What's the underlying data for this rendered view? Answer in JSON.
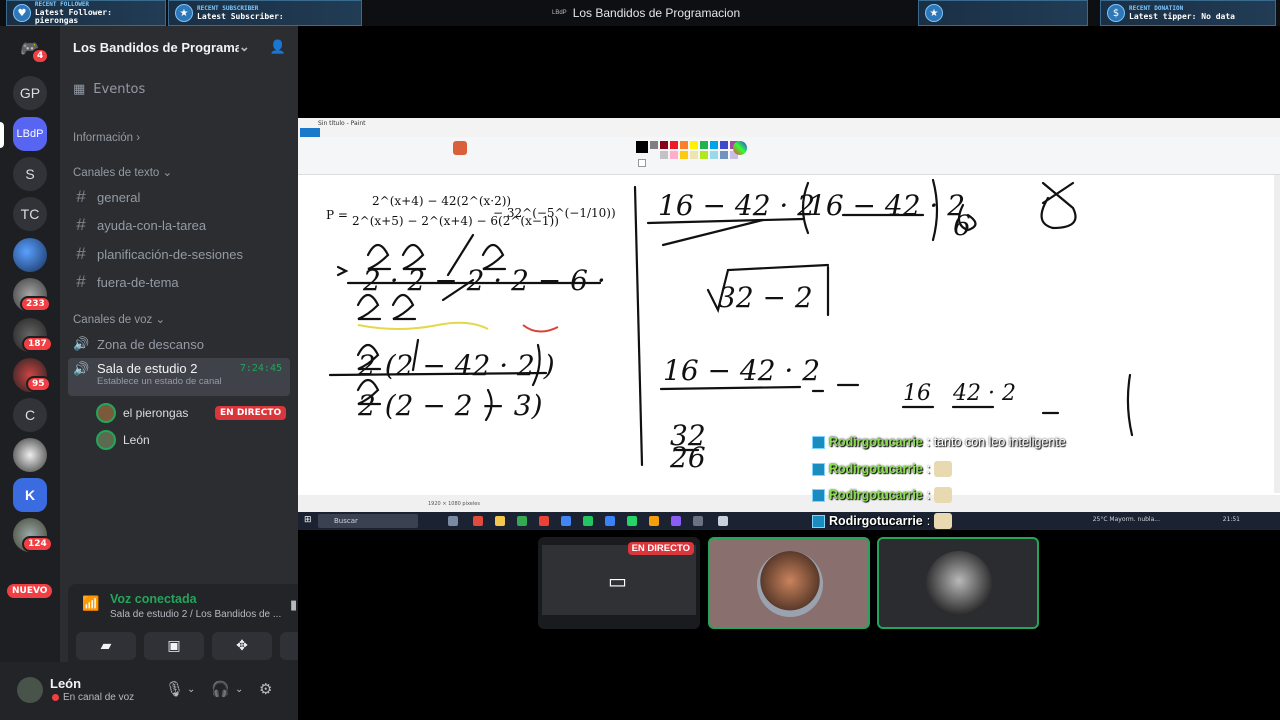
{
  "overlay": {
    "alerts_left": [
      {
        "key": "RECENT FOLLOWER",
        "value": "Latest Follower: pierongas"
      },
      {
        "key": "RECENT SUBSCRIBER",
        "value": "Latest Subscriber:"
      }
    ],
    "alerts_right": [
      {
        "key": "RECENT DONATION",
        "value": "Latest tipper: No data"
      }
    ],
    "window_logo": "LBdP",
    "window_title": "Los Bandidos de Programacion"
  },
  "rail": {
    "home_badge": "4",
    "servers": [
      "GP",
      "LBdP",
      "S",
      "TC",
      "C"
    ],
    "badges": {
      "s233": "233",
      "s187": "187",
      "s95": "95",
      "s124": "124"
    },
    "new_label": "NUEVO"
  },
  "sidebar": {
    "server_name": "Los Bandidos de Programa...",
    "events_label": "Eventos",
    "info_label": "Información",
    "text_category": "Canales de texto",
    "text_channels": [
      "general",
      "ayuda-con-la-tarea",
      "planificación-de-sesiones",
      "fuera-de-tema"
    ],
    "voice_category": "Canales de voz",
    "voice_channels": [
      {
        "name": "Zona de descanso"
      },
      {
        "name": "Sala de estudio 2",
        "sub": "Establece un estado de canal",
        "timer": "7:24:45"
      }
    ],
    "voice_users": [
      {
        "name": "el pierongas",
        "live": "EN DIRECTO"
      },
      {
        "name": "León"
      }
    ]
  },
  "voice_panel": {
    "title": "Voz conectada",
    "subtitle": "Sala de estudio 2 / Los Bandidos de ..."
  },
  "user": {
    "name": "León",
    "status": "En canal de voz"
  },
  "paint": {
    "title": "Sin título - Paint",
    "status": "1920 × 1080 píxeles",
    "taskbar_search": "Buscar",
    "taskbar_weather": "25°C Mayorm. nubla...",
    "taskbar_time": "21:51"
  },
  "chat": [
    {
      "user": "Rodirgotucarrie",
      "msg": ": tanto con leo inteligente"
    },
    {
      "user": "Rodirgotucarrie",
      "msg": ":"
    },
    {
      "user": "Rodirgotucarrie",
      "msg": ":"
    },
    {
      "user": "Rodirgotucarrie",
      "msg": ":"
    }
  ],
  "tiles": {
    "screen_live": "EN DIRECTO"
  },
  "colors": {
    "discord_green": "#23a55a",
    "live_red": "#da373c",
    "sidebar_bg": "#2b2d31",
    "rail_bg": "#1e1f22"
  }
}
